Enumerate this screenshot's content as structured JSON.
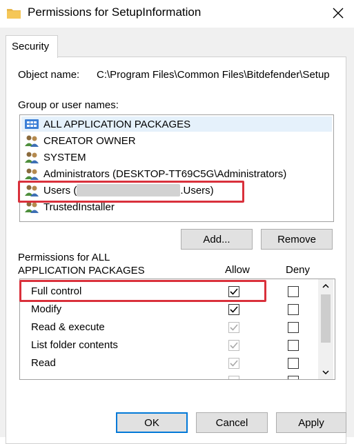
{
  "window": {
    "title": "Permissions for SetupInformation",
    "icon": "folder-icon",
    "close_icon": "close-icon"
  },
  "tabs": [
    {
      "label": "Security",
      "active": true
    }
  ],
  "object": {
    "label": "Object name:",
    "path": "C:\\Program Files\\Common Files\\Bitdefender\\Setup"
  },
  "group_list": {
    "label": "Group or user names:",
    "items": [
      {
        "name": "ALL APPLICATION PACKAGES",
        "icon": "app-packages-icon",
        "selected": true
      },
      {
        "name": "CREATOR OWNER",
        "icon": "users-icon"
      },
      {
        "name": "SYSTEM",
        "icon": "users-icon"
      },
      {
        "name": "Administrators (DESKTOP-TT69C5G\\Administrators)",
        "icon": "users-icon"
      },
      {
        "name_prefix": "Users (",
        "name_suffix": ".Users)",
        "redacted": true,
        "icon": "users-icon",
        "highlighted": true
      },
      {
        "name": "TrustedInstaller",
        "icon": "users-icon"
      }
    ]
  },
  "buttons": {
    "add": "Add...",
    "remove": "Remove",
    "ok": "OK",
    "cancel": "Cancel",
    "apply": "Apply"
  },
  "permissions": {
    "title": "Permissions for ALL APPLICATION PACKAGES",
    "title_line1": "Permissions for ALL",
    "title_line2": "APPLICATION PACKAGES",
    "allow_label": "Allow",
    "deny_label": "Deny",
    "rows": [
      {
        "name": "Full control",
        "allow": true,
        "allow_disabled": false,
        "deny": false,
        "highlighted": true,
        "focused": true
      },
      {
        "name": "Modify",
        "allow": true,
        "allow_disabled": false,
        "deny": false
      },
      {
        "name": "Read & execute",
        "allow": true,
        "allow_disabled": true,
        "deny": false
      },
      {
        "name": "List folder contents",
        "allow": true,
        "allow_disabled": true,
        "deny": false
      },
      {
        "name": "Read",
        "allow": true,
        "allow_disabled": true,
        "deny": false
      }
    ]
  },
  "colors": {
    "highlight_red": "#d9303b",
    "selection": "#e5f1fb",
    "dialog_bg": "#f0f0f0",
    "focus_blue": "#0078d7"
  }
}
